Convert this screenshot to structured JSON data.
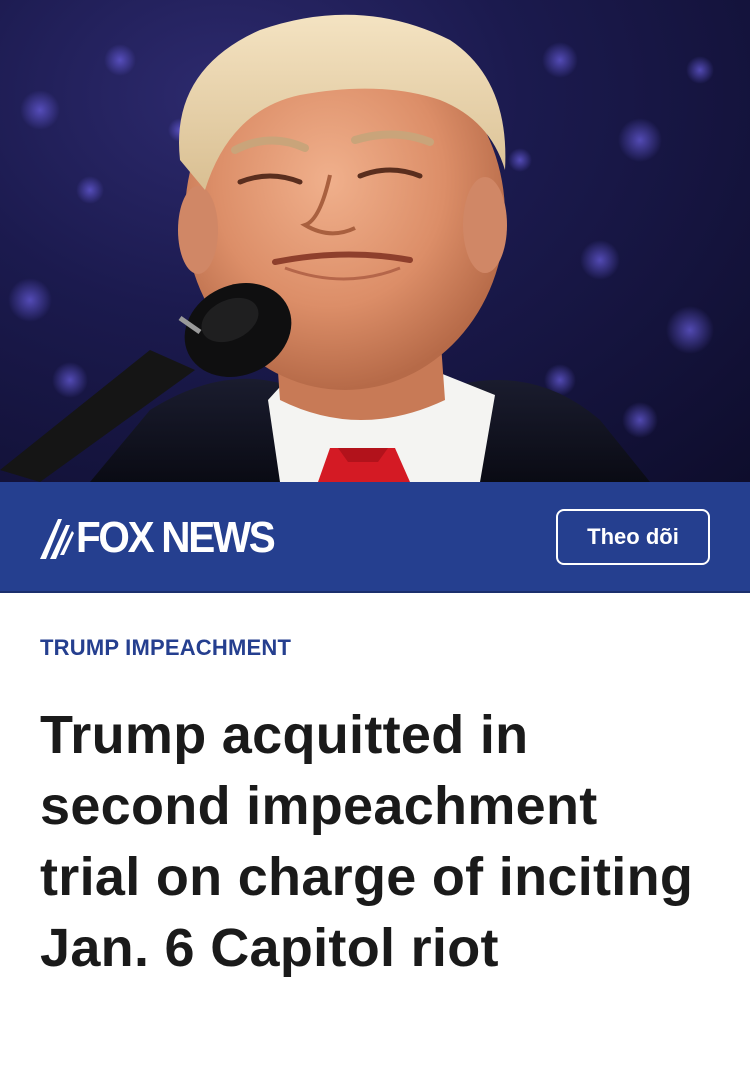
{
  "hero": {
    "image_label": "photo-speaker-at-microphone"
  },
  "publisher": {
    "name": "FOX NEWS",
    "follow_label": "Theo dõi",
    "brand_color": "#253f8f"
  },
  "article": {
    "category": "TRUMP IMPEACHMENT",
    "headline": "Trump acquitted in second impeachment trial on charge of inciting Jan. 6 Capitol riot",
    "category_color": "#253f8f",
    "headline_color": "#1a1a1a"
  }
}
